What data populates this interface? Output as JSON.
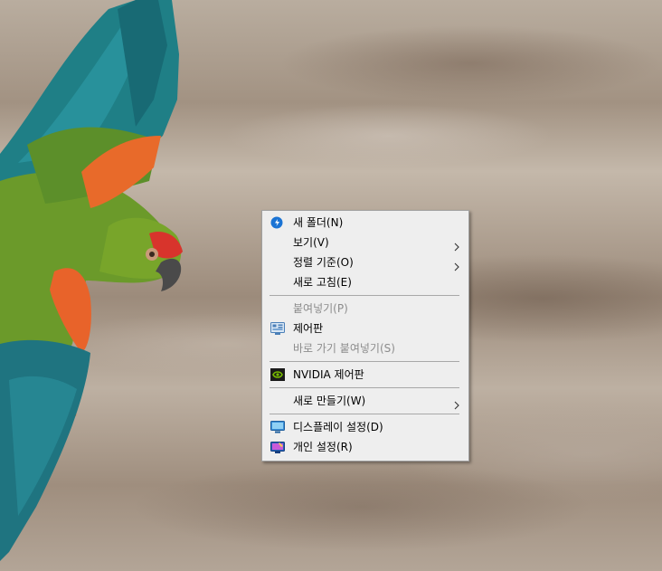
{
  "context_menu": {
    "items": [
      {
        "label": "새 폴더(N)",
        "icon": "new-folder-icon",
        "enabled": true
      },
      {
        "label": "보기(V)",
        "submenu": true,
        "enabled": true
      },
      {
        "label": "정렬 기준(O)",
        "submenu": true,
        "enabled": true
      },
      {
        "label": "새로 고침(E)",
        "enabled": true
      },
      {
        "label": "붙여넣기(P)",
        "enabled": false
      },
      {
        "label": "제어판",
        "icon": "control-panel-icon",
        "enabled": true
      },
      {
        "label": "바로 가기 붙여넣기(S)",
        "enabled": false
      },
      {
        "label": "NVIDIA 제어판",
        "icon": "nvidia-icon",
        "enabled": true
      },
      {
        "label": "새로 만들기(W)",
        "submenu": true,
        "enabled": true
      },
      {
        "label": "디스플레이 설정(D)",
        "icon": "display-icon",
        "enabled": true
      },
      {
        "label": "개인 설정(R)",
        "icon": "personalize-icon",
        "enabled": true
      }
    ]
  },
  "colors": {
    "menu_background": "#eeeeee",
    "disabled_text": "#8c8c8c",
    "nvidia_green": "#76b900",
    "accent_blue": "#1a73d4"
  }
}
